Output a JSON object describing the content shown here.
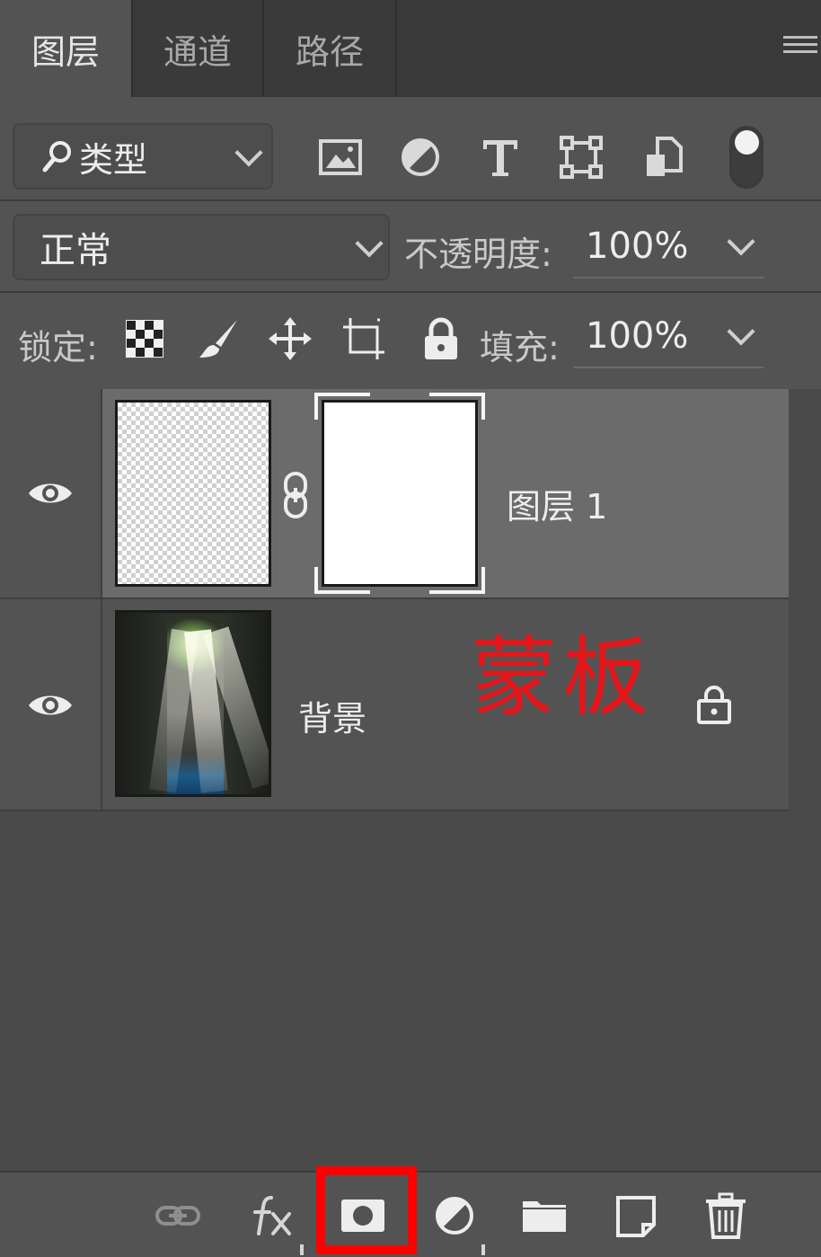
{
  "tabs": [
    {
      "label": "图层",
      "active": true
    },
    {
      "label": "通道",
      "active": false
    },
    {
      "label": "路径",
      "active": false
    }
  ],
  "filter": {
    "label": "类型",
    "icons": [
      "image-filter-icon",
      "adjustment-filter-icon",
      "text-filter-icon",
      "shape-filter-icon",
      "smart-object-filter-icon"
    ],
    "toggle": "on"
  },
  "blend": {
    "mode": "正常",
    "opacity_label": "不透明度:",
    "opacity_value": "100%"
  },
  "lock": {
    "label": "锁定:",
    "icons": [
      "lock-transparent-icon",
      "lock-image-icon",
      "lock-position-icon",
      "lock-artboard-icon",
      "lock-all-icon"
    ],
    "fill_label": "填充:",
    "fill_value": "100%"
  },
  "layers": [
    {
      "name": "图层 1",
      "visible": true,
      "has_mask": true,
      "selected": true
    },
    {
      "name": "背景",
      "visible": true,
      "locked": true,
      "selected": false
    }
  ],
  "annotation": {
    "text": "蒙板",
    "color": "#e5161a"
  },
  "bottom_icons": [
    "link-layers-icon",
    "fx-icon",
    "add-mask-icon",
    "adjustment-layer-icon",
    "group-folder-icon",
    "new-layer-icon",
    "trash-icon"
  ],
  "highlight_color": "#ff0000"
}
